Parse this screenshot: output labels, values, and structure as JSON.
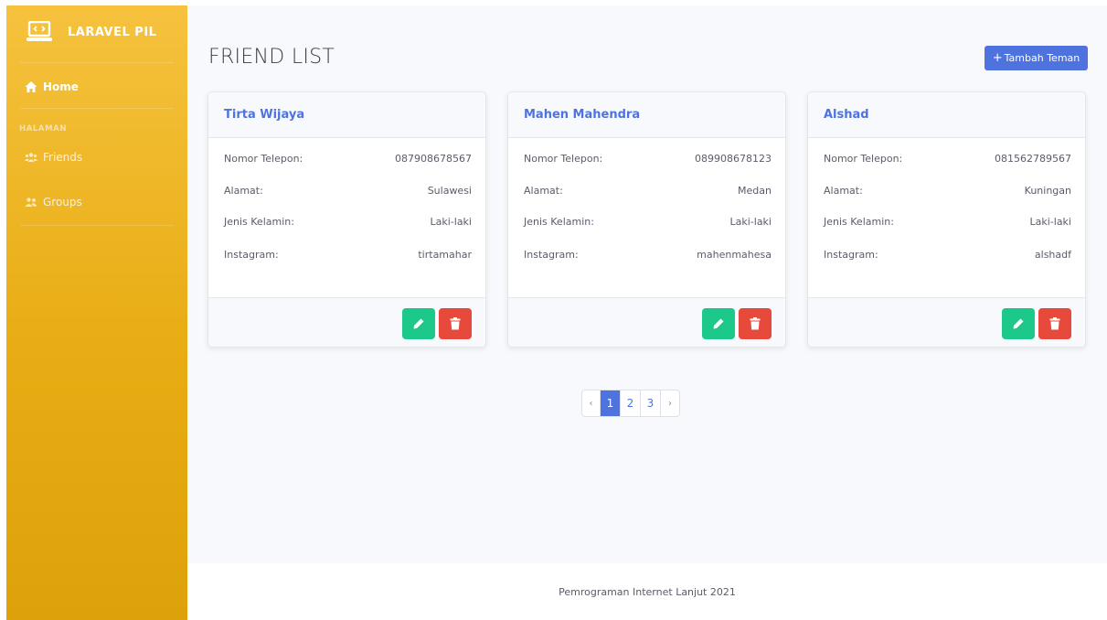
{
  "sidebar": {
    "brand": "LARAVEL PIL",
    "home_label": "Home",
    "heading": "HALAMAN",
    "friends_label": "Friends",
    "groups_label": "Groups"
  },
  "main": {
    "title": "FRIEND LIST",
    "add_button_label": "Tambah Teman",
    "field_labels": {
      "phone": "Nomor Telepon:",
      "address": "Alamat:",
      "gender": "Jenis Kelamin:",
      "instagram": "Instagram:"
    },
    "friends": [
      {
        "name": "Tirta Wijaya",
        "phone": "087908678567",
        "address": "Sulawesi",
        "gender": "Laki-laki",
        "instagram": "tirtamahar"
      },
      {
        "name": "Mahen Mahendra",
        "phone": "089908678123",
        "address": "Medan",
        "gender": "Laki-laki",
        "instagram": "mahenmahesa"
      },
      {
        "name": "Alshad",
        "phone": "081562789567",
        "address": "Kuningan",
        "gender": "Laki-laki",
        "instagram": "alshadf"
      }
    ]
  },
  "pagination": {
    "prev": "‹",
    "pages": [
      "1",
      "2",
      "3"
    ],
    "next": "›",
    "current": "1"
  },
  "footer": {
    "text": "Pemrograman Internet Lanjut 2021"
  },
  "colors": {
    "sidebar": "#f6c23e",
    "primary": "#4e73df",
    "success": "#1cc88a",
    "danger": "#e74a3b"
  }
}
